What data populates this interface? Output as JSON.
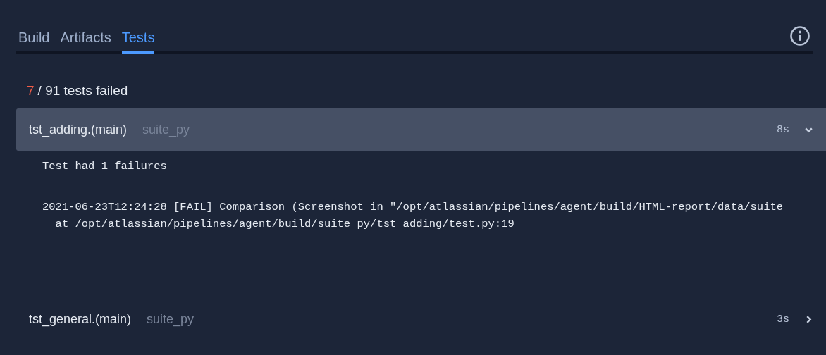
{
  "tabs": [
    {
      "label": "Build",
      "selected": false
    },
    {
      "label": "Artifacts",
      "selected": false
    },
    {
      "label": "Tests",
      "selected": true
    }
  ],
  "summary": {
    "failed": "7",
    "total": "/ 91 tests failed"
  },
  "tests": [
    {
      "name": "tst_adding.(main)",
      "suite": "suite_py",
      "duration": "8s",
      "expanded": true,
      "log": [
        "Test had 1 failures",
        "2021-06-23T12:24:28 [FAIL] Comparison (Screenshot in \"/opt/atlassian/pipelines/agent/build/HTML-report/data/suite_",
        "  at /opt/atlassian/pipelines/agent/build/suite_py/tst_adding/test.py:19"
      ]
    },
    {
      "name": "tst_general.(main)",
      "suite": "suite_py",
      "duration": "3s",
      "expanded": false
    }
  ]
}
